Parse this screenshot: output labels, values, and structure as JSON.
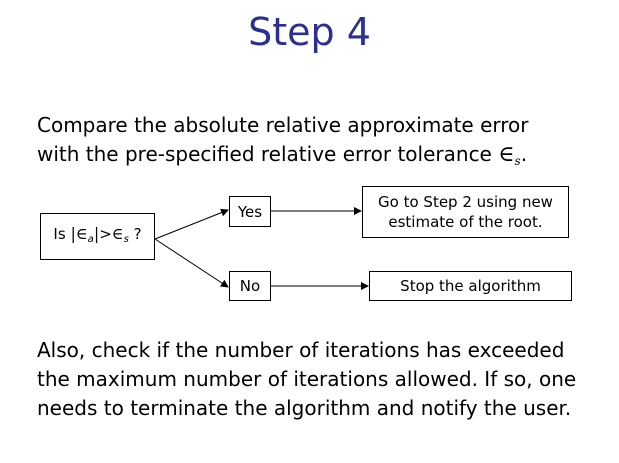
{
  "slide": {
    "title": "Step 4",
    "intro_line1": "Compare the absolute relative approximate error",
    "intro_line2": "with the pre-specified relative error tolerance",
    "intro_symbol": "∈",
    "intro_symbol_sub": "s",
    "intro_end": ".",
    "closing_text": "Also, check if the number of iterations has exceeded the maximum number of iterations allowed. If so, one needs to terminate the algorithm and notify the user."
  },
  "diagram": {
    "question": {
      "prefix": "Is",
      "bar_left": "|",
      "eps_a": "∈",
      "eps_a_sub": "a",
      "bar_right": "|",
      "op": ">",
      "eps_s": "∈",
      "eps_s_sub": "s",
      "suffix": "?"
    },
    "yes_label": "Yes",
    "no_label": "No",
    "yes_action_line1": "Go to Step 2 using new",
    "yes_action_line2": "estimate of the root.",
    "no_action": "Stop the algorithm"
  }
}
